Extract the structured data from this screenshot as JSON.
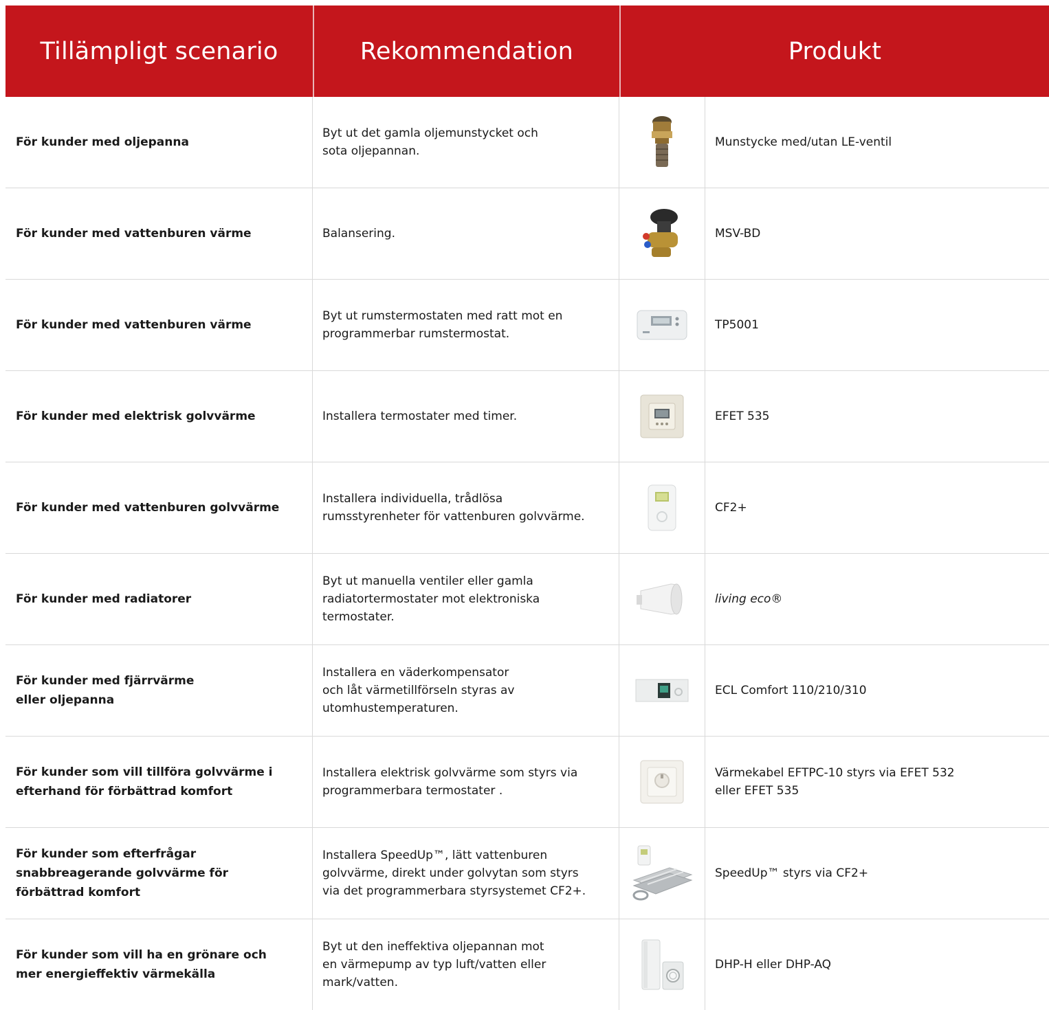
{
  "header": {
    "col1": "Tillämpligt scenario",
    "col2": "Rekommendation",
    "col3": "Produkt"
  },
  "rows": [
    {
      "scenario": "För kunder med oljepanna",
      "recommendation": "Byt ut det gamla oljemunstycket och\nsota oljepannan.",
      "product": "Munstycke med/utan LE-ventil",
      "icon": "nozzle-icon"
    },
    {
      "scenario": "För kunder med vattenburen värme",
      "recommendation": "Balansering.",
      "product": "MSV-BD",
      "icon": "balancing-valve-icon"
    },
    {
      "scenario": "För kunder med vattenburen värme",
      "recommendation": "Byt ut rumstermostaten med ratt mot en\nprogrammerbar rumstermostat.",
      "product": "TP5001",
      "icon": "room-thermostat-icon"
    },
    {
      "scenario": "För kunder med elektrisk golvvärme",
      "recommendation": "Installera termostater med timer.",
      "product": "EFET 535",
      "icon": "floor-thermostat-icon"
    },
    {
      "scenario": "För kunder med vattenburen golvvärme",
      "recommendation": "Installera individuella, trådlösa\nrumsstyrenheter för vattenburen golvvärme.",
      "product": "CF2+",
      "icon": "wireless-controller-icon"
    },
    {
      "scenario": "För kunder med radiatorer",
      "recommendation": "Byt ut manuella ventiler eller gamla\nradiatortermostater mot elektroniska\ntermostater.",
      "product": "living eco®",
      "icon": "radiator-thermostat-icon"
    },
    {
      "scenario": "För kunder med fjärrvärme\neller oljepanna",
      "recommendation": "Installera en väderkompensator\noch låt värmetillförseln styras av\nutomhustemperaturen.",
      "product": "ECL Comfort 110/210/310",
      "icon": "weather-compensator-icon"
    },
    {
      "scenario": "För kunder som vill tillföra golvvärme i\nefterhand för förbättrad komfort",
      "recommendation": "Installera elektrisk golvvärme som styrs via\nprogrammerbara termostater .",
      "product": "Värmekabel EFTPC-10 styrs via EFET 532\neller EFET 535",
      "icon": "dial-thermostat-icon"
    },
    {
      "scenario": "För kunder som efterfrågar\nsnabbreagerande golvvärme för\nförbättrad komfort",
      "recommendation": "Installera SpeedUp™, lätt vattenburen\ngolvvärme, direkt under golvytan som styrs\nvia det programmerbara styrsystemet CF2+.",
      "product": "SpeedUp™ styrs via CF2+",
      "icon": "floor-panel-icon"
    },
    {
      "scenario": "För kunder som vill ha en grönare och\nmer energieffektiv värmekälla",
      "recommendation": "Byt ut den ineffektiva oljepannan mot\nen värmepump av typ luft/vatten eller\nmark/vatten.",
      "product": "DHP-H eller DHP-AQ",
      "icon": "heat-pump-icon"
    }
  ]
}
